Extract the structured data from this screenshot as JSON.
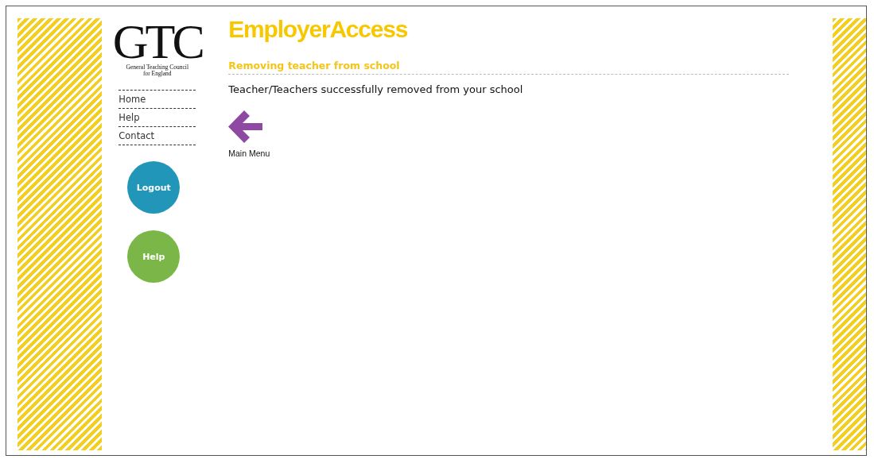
{
  "logo": {
    "mark": "GTC",
    "subtitle_line1": "General Teaching Council",
    "subtitle_line2": "for England"
  },
  "nav": [
    "Home",
    "Help",
    "Contact"
  ],
  "round_buttons": [
    {
      "label": "Logout",
      "color": "#2196b8"
    },
    {
      "label": "Help",
      "color": "#7ab648"
    }
  ],
  "app_title": "EmployerAccess",
  "heading": "Removing teacher from school",
  "message": "Teacher/Teachers successfully removed from your school",
  "back_link": {
    "label": "Main Menu"
  }
}
